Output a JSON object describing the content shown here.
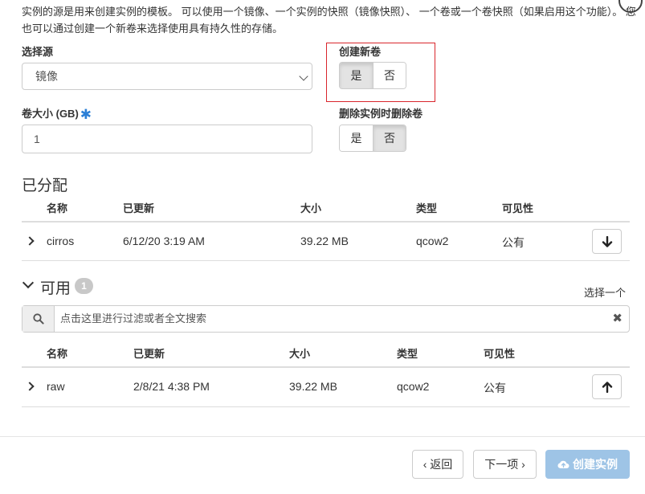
{
  "description": "实例的源是用来创建实例的模板。 可以使用一个镜像、一个实例的快照（镜像快照）、 一个卷或一个卷快照（如果启用这个功能）。 您也可以通过创建一个新卷来选择使用具有持久性的存储。",
  "source": {
    "label": "选择源",
    "value": "镜像"
  },
  "create_volume": {
    "label": "创建新卷",
    "yes": "是",
    "no": "否",
    "selected": "是"
  },
  "volume_size": {
    "label": "卷大小 (GB)",
    "required_mark": "✱",
    "value": "1"
  },
  "delete_volume": {
    "label": "删除实例时删除卷",
    "yes": "是",
    "no": "否",
    "selected": "否"
  },
  "allocated": {
    "title": "已分配",
    "headers": [
      "名称",
      "已更新",
      "大小",
      "类型",
      "可见性"
    ],
    "rows": [
      {
        "name": "cirros",
        "updated": "6/12/20 3:19 AM",
        "size": "39.22 MB",
        "type": "qcow2",
        "visibility": "公有"
      }
    ]
  },
  "available": {
    "title": "可用",
    "count": "1",
    "select_hint": "选择一个",
    "search_placeholder": "点击这里进行过滤或者全文搜索",
    "clear": "✖",
    "headers": [
      "名称",
      "已更新",
      "大小",
      "类型",
      "可见性"
    ],
    "rows": [
      {
        "name": "raw",
        "updated": "2/8/21 4:38 PM",
        "size": "39.22 MB",
        "type": "qcow2",
        "visibility": "公有"
      }
    ]
  },
  "footer": {
    "back": "‹ 返回",
    "next": "下一项 ›",
    "create": "创建实例"
  }
}
